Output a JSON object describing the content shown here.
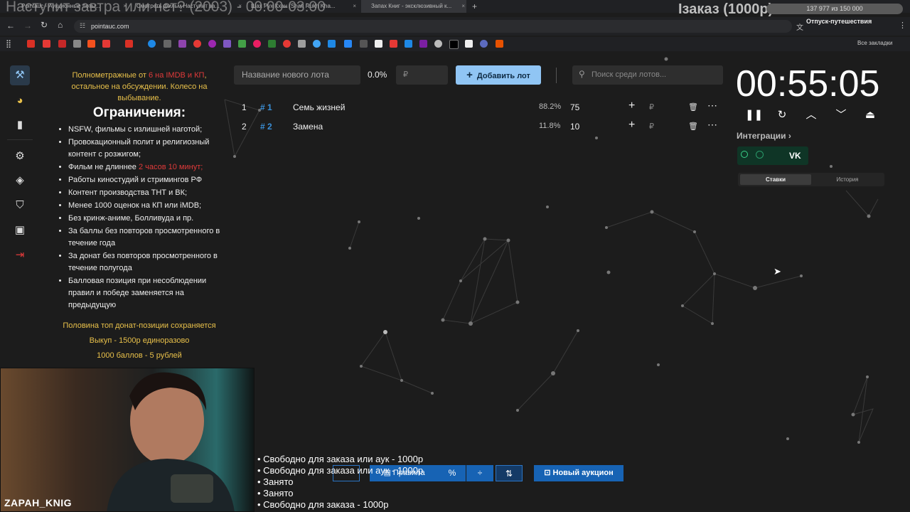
{
  "overlay": {
    "title": "Наступит завтра или нет? (2003) - 00:00-03:00",
    "order_badge": "Iзаказ (1000р)",
    "progress_text": "137 977 из 150 000"
  },
  "browser": {
    "tabs": [
      {
        "label": "Pointauc - Аукционные лоты..."
      },
      {
        "label": "Смотреть фильм Наступит за..."
      },
      {
        "label": "Шах Рух Кхан (Shah Rukh Kha..."
      },
      {
        "label": "Запах Книг - эксклюзивный к..."
      }
    ],
    "url": "pointauc.com",
    "status": "Отпуск-путешествия",
    "bookmarks_all": "Все закладки"
  },
  "rules": {
    "head_pre": "Полнометражные от ",
    "head_red": "6 на IMDB и КП",
    "head_post": ", остальное на обсуждении. Колесо на выбывание.",
    "title": "Ограничения:",
    "items": [
      "NSFW, фильмы с излишней наготой;",
      "Провокационный полит и религиозный контент с розжигом;",
      "Фильм не длиннее ",
      "Работы киностудий и стримингов РФ",
      "Контент производства ТНТ и ВК;",
      "Менее 1000 оценок на КП или iMDB;",
      "Без кринж-аниме, Болливуда и пр.",
      "За баллы без повторов просмотренного в течение года",
      "За донат без повторов просмотренного в течение полугода",
      "Балловая позиция при несоблюдении правил и победе заменяется на предыдущую"
    ],
    "item_red": "2 часов 10 минут;",
    "footer": [
      "Половина топ донат-позиции сохраняется",
      "Выкуп - 1500р единоразово",
      "1000 баллов - 5 рублей"
    ]
  },
  "lot_form": {
    "name_placeholder": "Название нового лота",
    "percent": "0.0%",
    "amount_placeholder": "₽",
    "add_button": "Добавить лот",
    "search_placeholder": "Поиск среди лотов..."
  },
  "lots": [
    {
      "num": "1",
      "hash": "# 1",
      "name": "Семь жизней",
      "pct": "88.2%",
      "amount": "75",
      "currency": "₽"
    },
    {
      "num": "2",
      "hash": "# 2",
      "name": "Замена",
      "pct": "11.8%",
      "amount": "10",
      "currency": "₽"
    }
  ],
  "timer": "00:55:05",
  "integrations": {
    "label": "Интеграции",
    "vk": "VK"
  },
  "tabs": {
    "bids": "Ставки",
    "history": "История"
  },
  "toolbar": {
    "rules": "Правила",
    "new_auction": "Новый аукцион"
  },
  "slots": [
    "• Свободно для заказа или аук - 1000р",
    "• Свободно для заказа или аук - 1000р",
    "• Занято",
    "• Занято",
    "• Свободно для заказа - 1000р"
  ],
  "webcam": {
    "name": "ZAPAH_KNIG"
  },
  "colors": {
    "accent": "#90c5f4",
    "gold": "#e8c04a",
    "red": "#e03a3a",
    "toolbar_blue": "#1763b4"
  }
}
